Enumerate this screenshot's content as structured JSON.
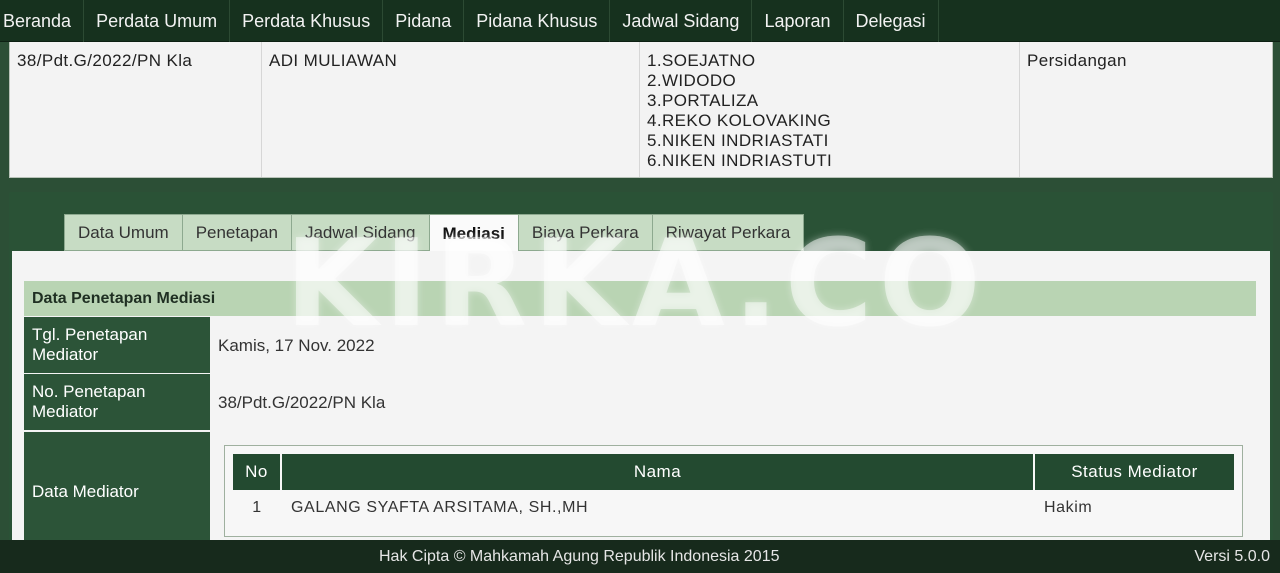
{
  "nav": {
    "items": [
      "Beranda",
      "Perdata Umum",
      "Perdata Khusus",
      "Pidana",
      "Pidana Khusus",
      "Jadwal Sidang",
      "Laporan",
      "Delegasi"
    ]
  },
  "case": {
    "number": "38/Pdt.G/2022/PN Kla",
    "party": "ADI MULIAWAN",
    "judges": [
      "1.SOEJATNO",
      "2.WIDODO",
      "3.PORTALIZA",
      "4.REKO KOLOVAKING",
      "5.NIKEN INDRIASTATI",
      "6.NIKEN INDRIASTUTI"
    ],
    "status": "Persidangan"
  },
  "tabs": [
    "Data Umum",
    "Penetapan",
    "Jadwal Sidang",
    "Mediasi",
    "Biaya Perkara",
    "Riwayat Perkara"
  ],
  "active_tab": "Mediasi",
  "mediasi": {
    "section_title": "Data Penetapan Mediasi",
    "tgl_label": "Tgl. Penetapan Mediator",
    "tgl_value": "Kamis, 17 Nov. 2022",
    "no_label": "No. Penetapan Mediator",
    "no_value": "38/Pdt.G/2022/PN Kla",
    "mediator_label": "Data Mediator",
    "table": {
      "headers": [
        "No",
        "Nama",
        "Status Mediator"
      ],
      "rows": [
        [
          "1",
          "GALANG SYAFTA ARSITAMA, SH.,MH",
          "Hakim"
        ]
      ]
    }
  },
  "watermark": "KIRKA.CO",
  "footer": {
    "copyright": "Hak Cipta © Mahkamah Agung Republik Indonesia 2015",
    "version": "Versi 5.0.0"
  }
}
